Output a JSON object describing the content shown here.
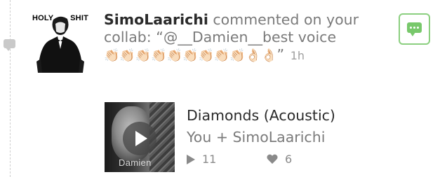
{
  "notification": {
    "avatar": {
      "left_text": "HOLY",
      "right_text": "SHIT"
    },
    "username": "SimoLaarichi",
    "action_text": " commented on your collab: “@__Damien__best voice ",
    "emoji_sequence": "👏🏻👏🏻👏🏻👏🏻👏🏻👏🏻👏🏻👏🏻👏🏻👌🏻👌🏻",
    "closing_quote": "”",
    "time": "1h",
    "comment_icon": "comment-icon"
  },
  "collab": {
    "thumbnail_brand": "Damien",
    "title": "Diamonds (Acoustic)",
    "artists": "You + SimoLaarichi",
    "plays": "11",
    "likes": "6"
  },
  "colors": {
    "accent_green": "#78c86b",
    "text_dark": "#2a2a2a",
    "text_gray": "#7a7a7a"
  }
}
